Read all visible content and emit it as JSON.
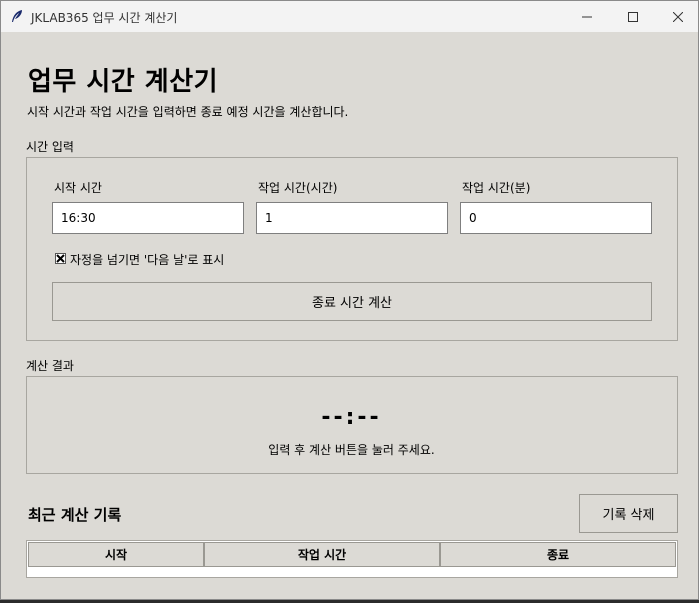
{
  "window": {
    "title": "JKLAB365 업무 시간 계산기"
  },
  "header": {
    "title": "업무 시간 계산기",
    "subtitle": "시작 시간과 작업 시간을 입력하면 종료 예정 시간을 계산합니다."
  },
  "input_group": {
    "label": "시간 입력",
    "start_label": "시작 시간",
    "start_value": "16:30",
    "hours_label": "작업 시간(시간)",
    "hours_value": "1",
    "minutes_label": "작업 시간(분)",
    "minutes_value": "0",
    "next_day_checked": true,
    "next_day_label": "자정을 넘기면 '다음 날'로 표시",
    "calc_button": "종료 시간 계산"
  },
  "result_group": {
    "label": "계산 결과",
    "time": "--:--",
    "message": "입력 후 계산 버튼을 눌러 주세요."
  },
  "history": {
    "title": "최근 계산 기록",
    "clear_button": "기록 삭제",
    "columns": [
      "시작",
      "작업 시간",
      "종료"
    ]
  },
  "colors": {
    "background": "#dcdad5",
    "entry": "#ffffff",
    "titlebar": "#f3f3f3"
  }
}
